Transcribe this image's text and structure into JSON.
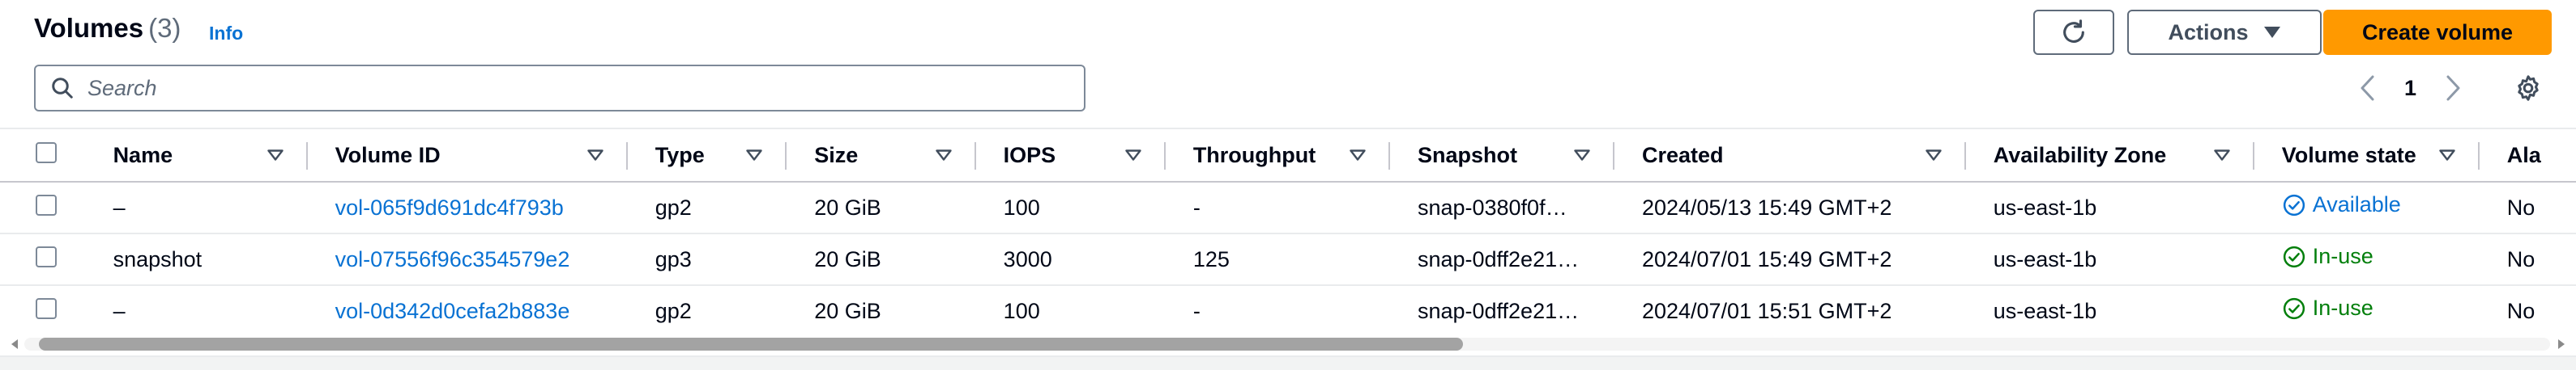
{
  "header": {
    "title": "Volumes",
    "count": "(3)",
    "info_link": "Info",
    "actions_label": "Actions",
    "create_label": "Create volume"
  },
  "search": {
    "placeholder": "Search"
  },
  "pagination": {
    "current_page": "1"
  },
  "table": {
    "columns": [
      "Name",
      "Volume ID",
      "Type",
      "Size",
      "IOPS",
      "Throughput",
      "Snapshot",
      "Created",
      "Availability Zone",
      "Volume state",
      "Ala"
    ],
    "rows": [
      {
        "name": "–",
        "volume_id": "vol-065f9d691dc4f793b",
        "type": "gp2",
        "size": "20 GiB",
        "iops": "100",
        "throughput": "-",
        "snapshot": "snap-0380f0f…",
        "created": "2024/05/13 15:49 GMT+2",
        "az": "us-east-1b",
        "state": "Available",
        "alarm": "No"
      },
      {
        "name": "snapshot",
        "volume_id": "vol-07556f96c354579e2",
        "type": "gp3",
        "size": "20 GiB",
        "iops": "3000",
        "throughput": "125",
        "snapshot": "snap-0dff2e21…",
        "created": "2024/07/01 15:49 GMT+2",
        "az": "us-east-1b",
        "state": "In-use",
        "alarm": "No"
      },
      {
        "name": "–",
        "volume_id": "vol-0d342d0cefa2b883e",
        "type": "gp2",
        "size": "20 GiB",
        "iops": "100",
        "throughput": "-",
        "snapshot": "snap-0dff2e21…",
        "created": "2024/07/01 15:51 GMT+2",
        "az": "us-east-1b",
        "state": "In-use",
        "alarm": "No"
      }
    ]
  },
  "colors": {
    "primary_button": "#ff9900",
    "link": "#0972d3",
    "status_available": "#0972d3",
    "status_inuse": "#037f0c"
  },
  "icons": [
    "refresh-icon",
    "caret-down-icon",
    "search-icon",
    "chevron-left-icon",
    "chevron-right-icon",
    "settings-gear-icon",
    "sort-caret-icon",
    "status-available-icon",
    "status-success-icon"
  ]
}
